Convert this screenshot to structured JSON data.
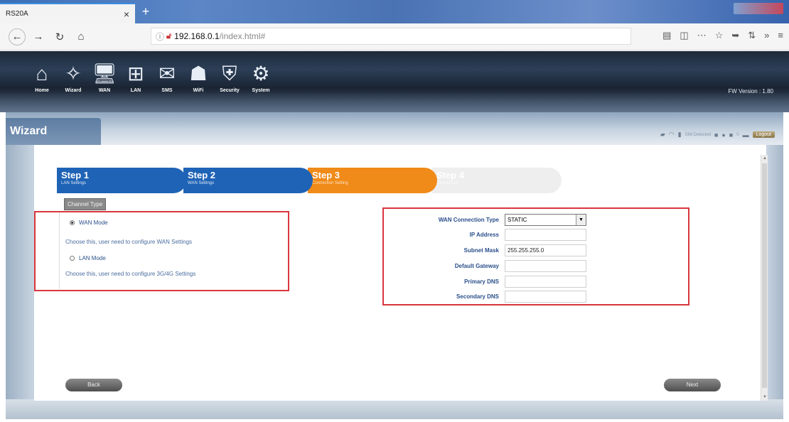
{
  "browser": {
    "tab_title": "RS20A",
    "tab_close": "×",
    "new_tab": "+",
    "url_host": "192.168.0.1",
    "url_path": "/index.html#"
  },
  "router": {
    "menu": [
      {
        "label": "Home",
        "icon": "home-icon"
      },
      {
        "label": "Wizard",
        "icon": "wizard-icon"
      },
      {
        "label": "WAN",
        "icon": "wan-icon"
      },
      {
        "label": "LAN",
        "icon": "lan-icon"
      },
      {
        "label": "SMS",
        "icon": "sms-icon"
      },
      {
        "label": "WiFi",
        "icon": "wifi-icon"
      },
      {
        "label": "Security",
        "icon": "security-icon"
      },
      {
        "label": "System",
        "icon": "system-icon"
      }
    ],
    "fw_version": "FW Version : 1.80"
  },
  "wizard": {
    "title": "Wizard",
    "status": {
      "sim_text": "SIM Detected",
      "count": "0",
      "logout": "Logout"
    },
    "steps": [
      {
        "title": "Step 1",
        "sub": "LAN Settings"
      },
      {
        "title": "Step 2",
        "sub": "WAN Settings"
      },
      {
        "title": "Step 3",
        "sub": "Connection Setting"
      },
      {
        "title": "Step 4",
        "sub": "Connection"
      }
    ],
    "channel_type": "Channel Type",
    "wan_mode": "WAN Mode",
    "wan_desc": "Choose this, user need to configure WAN Settings",
    "lan_mode": "LAN Mode",
    "lan_desc": "Choose this, user need to configure 3G/4G Settings",
    "form": {
      "conn_type_label": "WAN Connection Type",
      "conn_type_value": "STATIC",
      "ip_label": "IP Address",
      "ip_value": "",
      "mask_label": "Subnet Mask",
      "mask_value": "255.255.255.0",
      "gateway_label": "Default Gateway",
      "gateway_value": "",
      "dns1_label": "Primary DNS",
      "dns1_value": "",
      "dns2_label": "Secondary DNS",
      "dns2_value": ""
    },
    "back": "Back",
    "next": "Next"
  }
}
